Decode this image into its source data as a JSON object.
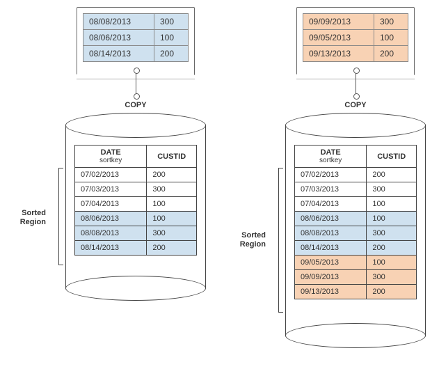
{
  "left": {
    "staging": [
      {
        "date": "08/08/2013",
        "val": "300"
      },
      {
        "date": "08/06/2013",
        "val": "100"
      },
      {
        "date": "08/14/2013",
        "val": "200"
      }
    ],
    "copy_label": "COPY",
    "headers": {
      "date": "DATE",
      "sortkey": "sortkey",
      "custid": "CUSTID"
    },
    "region_label": "Sorted Region",
    "rows": [
      {
        "date": "07/02/2013",
        "custid": "200",
        "cls": ""
      },
      {
        "date": "07/03/2013",
        "custid": "300",
        "cls": ""
      },
      {
        "date": "07/04/2013",
        "custid": "100",
        "cls": ""
      },
      {
        "date": "08/06/2013",
        "custid": "100",
        "cls": "blue-row"
      },
      {
        "date": "08/08/2013",
        "custid": "300",
        "cls": "blue-row"
      },
      {
        "date": "08/14/2013",
        "custid": "200",
        "cls": "blue-row"
      }
    ]
  },
  "right": {
    "staging": [
      {
        "date": "09/09/2013",
        "val": "300"
      },
      {
        "date": "09/05/2013",
        "val": "100"
      },
      {
        "date": "09/13/2013",
        "val": "200"
      }
    ],
    "copy_label": "COPY",
    "headers": {
      "date": "DATE",
      "sortkey": "sortkey",
      "custid": "CUSTID"
    },
    "region_label": "Sorted Region",
    "rows": [
      {
        "date": "07/02/2013",
        "custid": "200",
        "cls": ""
      },
      {
        "date": "07/03/2013",
        "custid": "300",
        "cls": ""
      },
      {
        "date": "07/04/2013",
        "custid": "100",
        "cls": ""
      },
      {
        "date": "08/06/2013",
        "custid": "100",
        "cls": "blue-row"
      },
      {
        "date": "08/08/2013",
        "custid": "300",
        "cls": "blue-row"
      },
      {
        "date": "08/14/2013",
        "custid": "200",
        "cls": "blue-row"
      },
      {
        "date": "09/05/2013",
        "custid": "100",
        "cls": "orange-row"
      },
      {
        "date": "09/09/2013",
        "custid": "300",
        "cls": "orange-row"
      },
      {
        "date": "09/13/2013",
        "custid": "200",
        "cls": "orange-row"
      }
    ]
  }
}
